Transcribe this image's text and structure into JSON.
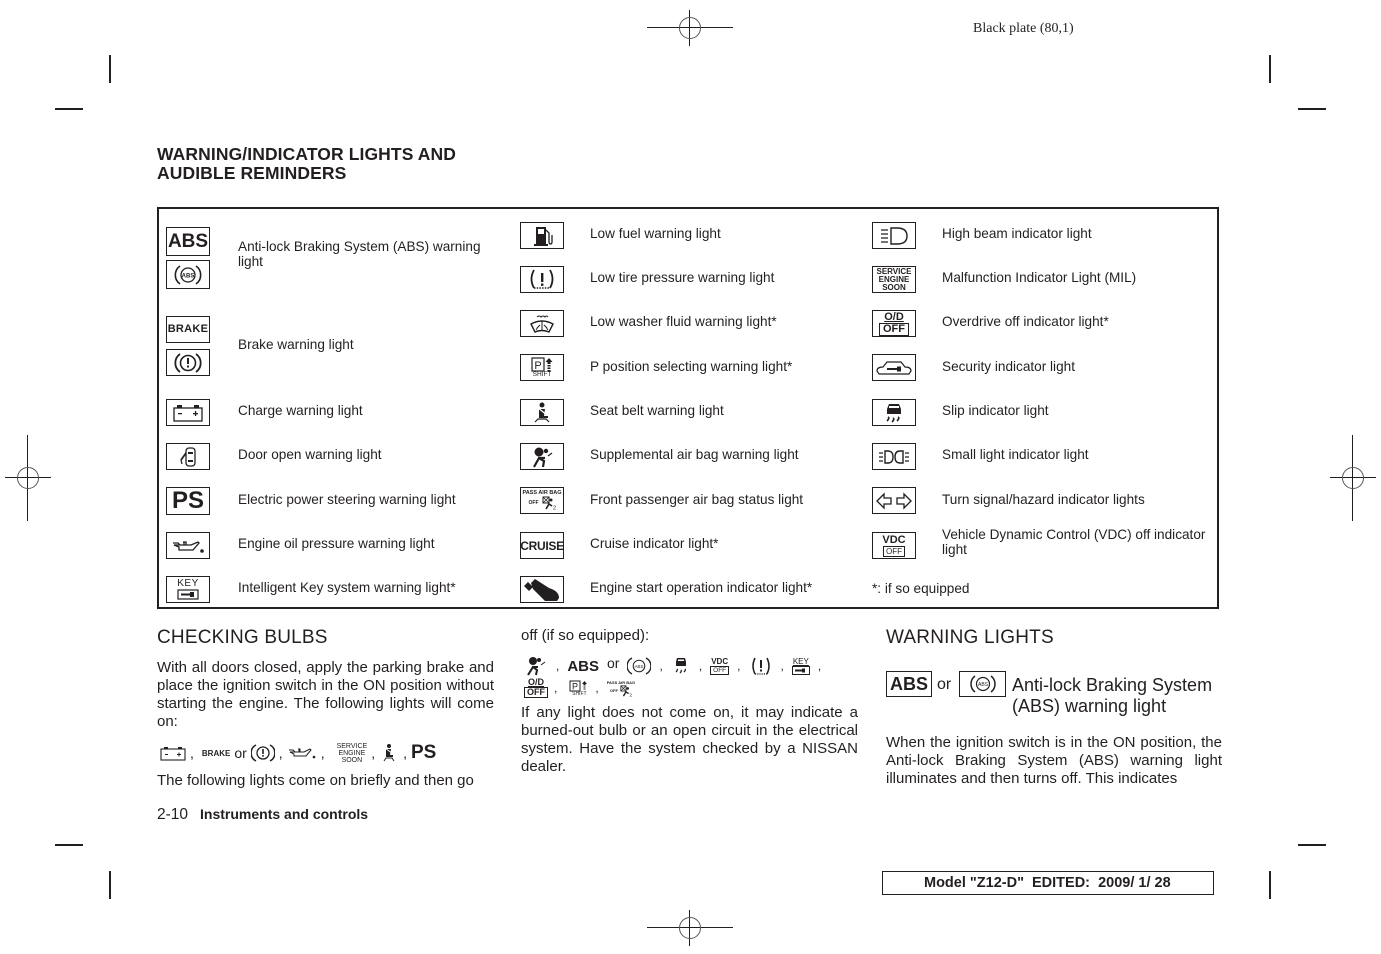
{
  "header": {
    "plate": "Black plate (80,1)"
  },
  "section": {
    "title_line1": "WARNING/INDICATOR LIGHTS AND",
    "title_line2": "AUDIBLE REMINDERS"
  },
  "table": {
    "columns": [
      {
        "rows": [
          {
            "icons": [
              "abs-text-icon",
              "abs-circle-icon"
            ],
            "label": "Anti-lock Braking System (ABS) warning light"
          },
          {
            "icons": [
              "brake-text-icon",
              "brake-circle-icon"
            ],
            "label": "Brake warning light"
          },
          {
            "icons": [
              "battery-icon"
            ],
            "label": "Charge warning light"
          },
          {
            "icons": [
              "door-open-icon"
            ],
            "label": "Door open warning light"
          },
          {
            "icons": [
              "ps-icon"
            ],
            "label": "Electric power steering warning light"
          },
          {
            "icons": [
              "oil-can-icon"
            ],
            "label": "Engine oil pressure warning light"
          },
          {
            "icons": [
              "key-icon"
            ],
            "label": "Intelligent Key system warning light*"
          }
        ]
      },
      {
        "rows": [
          {
            "icons": [
              "fuel-pump-icon"
            ],
            "label": "Low fuel warning light"
          },
          {
            "icons": [
              "tire-pressure-icon"
            ],
            "label": "Low tire pressure warning light"
          },
          {
            "icons": [
              "washer-fluid-icon"
            ],
            "label": "Low washer fluid warning light*"
          },
          {
            "icons": [
              "p-shift-icon"
            ],
            "label": "P position selecting warning light*"
          },
          {
            "icons": [
              "seat-belt-icon"
            ],
            "label": "Seat belt warning light"
          },
          {
            "icons": [
              "airbag-icon"
            ],
            "label": "Supplemental air bag warning light"
          },
          {
            "icons": [
              "pass-airbag-off-icon"
            ],
            "label": "Front passenger air bag status light"
          },
          {
            "icons": [
              "cruise-icon"
            ],
            "label": "Cruise indicator light*"
          },
          {
            "icons": [
              "engine-start-icon"
            ],
            "label": "Engine start operation indicator light*"
          }
        ]
      },
      {
        "rows": [
          {
            "icons": [
              "high-beam-icon"
            ],
            "label": "High beam indicator light"
          },
          {
            "icons": [
              "service-engine-soon-icon"
            ],
            "label": "Malfunction Indicator Light (MIL)"
          },
          {
            "icons": [
              "od-off-icon"
            ],
            "label": "Overdrive off indicator light*"
          },
          {
            "icons": [
              "security-icon"
            ],
            "label": "Security indicator light"
          },
          {
            "icons": [
              "slip-icon"
            ],
            "label": "Slip indicator light"
          },
          {
            "icons": [
              "small-light-icon"
            ],
            "label": "Small light indicator light"
          },
          {
            "icons": [
              "turn-signal-icon"
            ],
            "label": "Turn signal/hazard indicator lights"
          },
          {
            "icons": [
              "vdc-off-icon"
            ],
            "label": "Vehicle Dynamic Control (VDC) off indicator light"
          }
        ],
        "footnote": "*: if so equipped"
      }
    ],
    "icon_text": {
      "abs": "ABS",
      "brake": "BRAKE",
      "ps": "PS",
      "key": "KEY",
      "shift": "SHIFT",
      "pass_airbag": "PASS AIR BAG",
      "off_small": "OFF",
      "cruise": "CRUISE",
      "service": "SERVICE",
      "engine": "ENGINE",
      "soon": "SOON",
      "od": "O/D",
      "off": "OFF",
      "vdc": "VDC",
      "abs_small": "ABS"
    }
  },
  "checking_bulbs": {
    "heading": "CHECKING BULBS",
    "para1": "With all doors closed, apply the parking brake and place the ignition switch in the ON position without starting the engine. The following lights will come on:",
    "sep_comma": ",",
    "or": "or",
    "para2": "The following lights come on briefly and then go",
    "para2_cont": "off (if so equipped):",
    "para3": "If any light does not come on, it may indicate a burned-out bulb or an open circuit in the electrical system. Have the system checked by a NISSAN dealer."
  },
  "warning_lights": {
    "heading": "WARNING LIGHTS",
    "abs_text": "ABS",
    "or": "or",
    "abs_title": "Anti-lock Braking System (ABS) warning light",
    "para": "When the ignition switch is in the ON position, the Anti-lock Braking System (ABS) warning light illuminates and then turns off. This indicates"
  },
  "footer": {
    "page_number": "2-10",
    "chapter": "Instruments and controls",
    "model_info": "Model \"Z12-D\"  EDITED:  2009/ 1/ 28"
  }
}
